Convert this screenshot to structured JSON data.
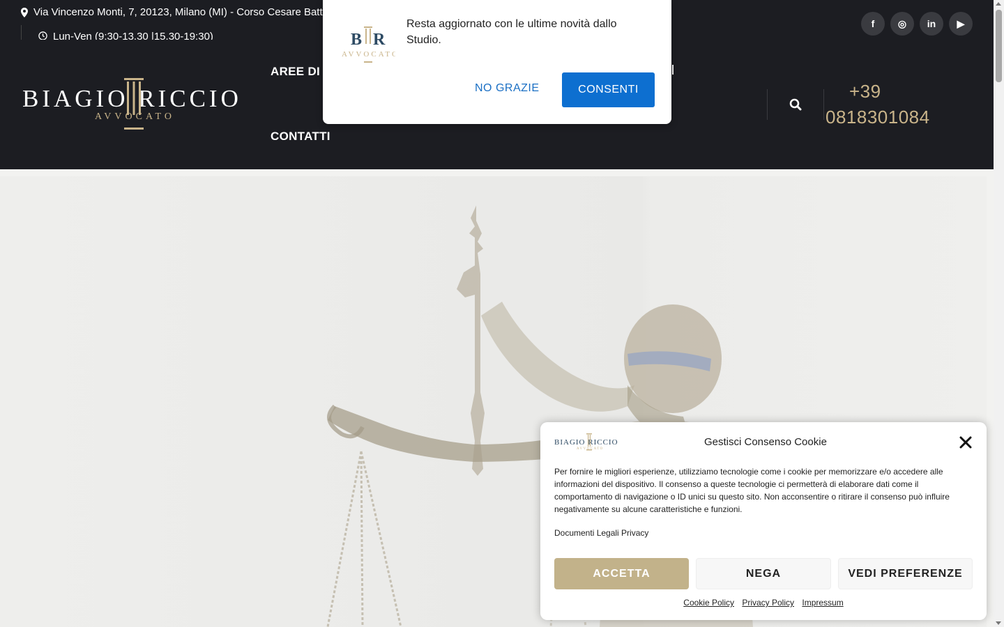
{
  "topbar": {
    "address": "Via Vincenzo Monti, 7, 20123, Milano (MI) - Corso Cesare Battisti",
    "hours": "Lun-Ven (9:30-13.30 |15.30-19:30)",
    "socials": [
      {
        "icon": "facebook-icon",
        "glyph": "f"
      },
      {
        "icon": "instagram-icon",
        "glyph": "◎"
      },
      {
        "icon": "linkedin-icon",
        "glyph": "in"
      },
      {
        "icon": "youtube-icon",
        "glyph": "▶"
      }
    ]
  },
  "header": {
    "logo_name": "BIAGIO  RICCIO",
    "logo_sub": "AVVOCATO",
    "nav": [
      "AREE DI P",
      "CONTATTI"
    ],
    "phone_line1": "+39",
    "phone_line2": "0818301084",
    "accent": "#c9b48a",
    "background": "#1c1d22"
  },
  "push": {
    "logo_letters": "B R",
    "logo_sub": "AVVOCATO",
    "message": "Resta aggiornato con le ultime novità dallo Studio.",
    "decline": "NO GRAZIE",
    "accept": "CONSENTI",
    "button_color": "#0d6fd0"
  },
  "cookie": {
    "logo_name": "BIAGIO RICCIO",
    "logo_sub": "AVVOCATO",
    "title": "Gestisci Consenso Cookie",
    "text": "Per fornire le migliori esperienze, utilizziamo tecnologie come i cookie per memorizzare e/o accedere alle informazioni del dispositivo. Il consenso a queste tecnologie ci permetterà di elaborare dati come il comportamento di navigazione o ID unici su questo sito. Non acconsentire o ritirare il consenso può influire negativamente su alcune caratteristiche e funzioni.",
    "legal": "Documenti Legali Privacy",
    "accept": "ACCETTA",
    "deny": "NEGA",
    "preferences": "VEDI PREFERENZE",
    "links": [
      "Cookie Policy",
      "Privacy Policy",
      "Impressum"
    ]
  }
}
